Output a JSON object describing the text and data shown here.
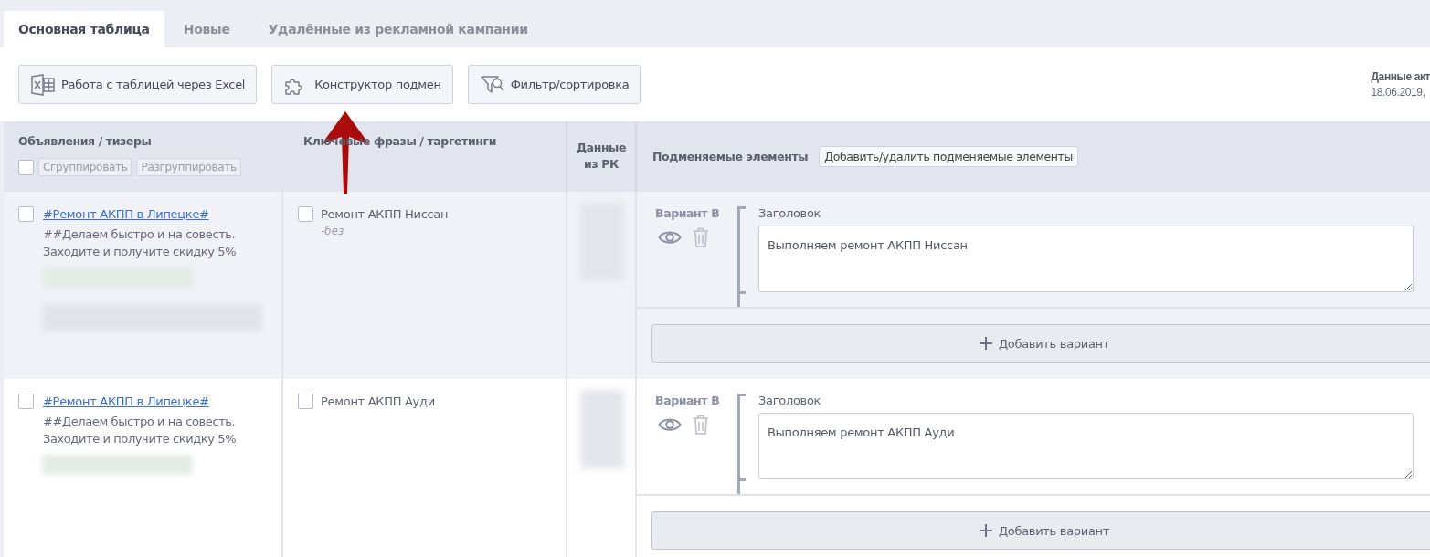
{
  "tabs": [
    {
      "label": "Основная таблица",
      "selected": true
    },
    {
      "label": "Новые",
      "selected": false
    },
    {
      "label": "Удалённые из рекламной кампании",
      "selected": false
    }
  ],
  "toolbar": {
    "buttons": [
      {
        "label": "Работа с таблицей через Excel",
        "kind": "excel"
      },
      {
        "label": "Конструктор подмен",
        "kind": "puzzle"
      },
      {
        "label": "Фильтр/сортировка",
        "kind": "filter"
      }
    ],
    "data_status": {
      "title": "Данные акт",
      "date": "18.06.2019,"
    }
  },
  "table": {
    "columns": {
      "ads": "Объявления / тизеры",
      "keywords": "Ключевые фразы / таргетинги",
      "campaign_data": "Данные из РК",
      "replaced": "Подменяемые элементы"
    },
    "select_all": {
      "checked": false
    },
    "group_buttons": [
      "Сгруппировать",
      "Разгруппировать"
    ],
    "edit_elements_button": "Добавить/удалить подменяемые элементы",
    "rows": [
      {
        "ad": {
          "checked": false,
          "title": "#Ремонт АКПП в Липецке#",
          "text": "##Делаем быстро и на совесть. Заходите и получите скидку 5%",
          "redactions": [
            {
              "kind": "green"
            },
            {
              "kind": "grey"
            }
          ]
        },
        "keyword": {
          "checked": false,
          "phrase": "Ремонт АКПП Ниссан",
          "minus": "-без"
        },
        "variant": {
          "label": "Вариант B",
          "field_label": "Заголовок",
          "value": "Выполняем ремонт АКПП Ниссан"
        },
        "add_variant": "Добавить вариант"
      },
      {
        "ad": {
          "checked": false,
          "title": "#Ремонт АКПП в Липецке#",
          "text": "##Делаем быстро и на совесть. Заходите и получите скидку 5%",
          "redactions": [
            {
              "kind": "green"
            }
          ]
        },
        "keyword": {
          "checked": false,
          "phrase": "Ремонт АКПП Ауди"
        },
        "variant": {
          "label": "Вариант B",
          "field_label": "Заголовок",
          "value": "Выполняем ремонт АКПП Ауди"
        },
        "add_variant": "Добавить вариант"
      }
    ]
  },
  "annotation": {
    "kind": "arrow"
  }
}
